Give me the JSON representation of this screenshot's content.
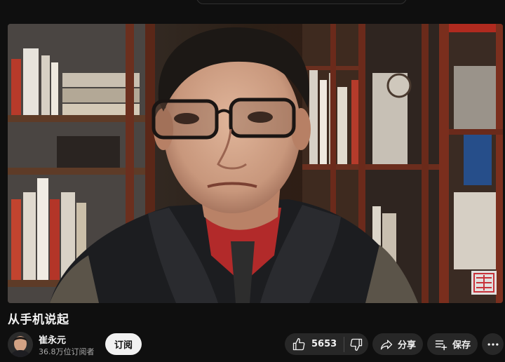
{
  "video": {
    "title": "从手机说起"
  },
  "channel": {
    "name": "崔永元",
    "subscribers": "36.8万位订阅者",
    "subscribe_label": "订阅"
  },
  "actions": {
    "like_count": "5653",
    "share_label": "分享",
    "save_label": "保存"
  },
  "icons": {
    "like": "thumbs-up-icon",
    "dislike": "thumbs-down-icon",
    "share": "share-arrow-icon",
    "save": "save-playlist-icon",
    "more": "more-horizontal-icon"
  },
  "colors": {
    "background": "#0f0f0f",
    "pill": "#272727",
    "subscribe_bg": "#f1f1f1",
    "subtext": "#aaaaaa"
  }
}
